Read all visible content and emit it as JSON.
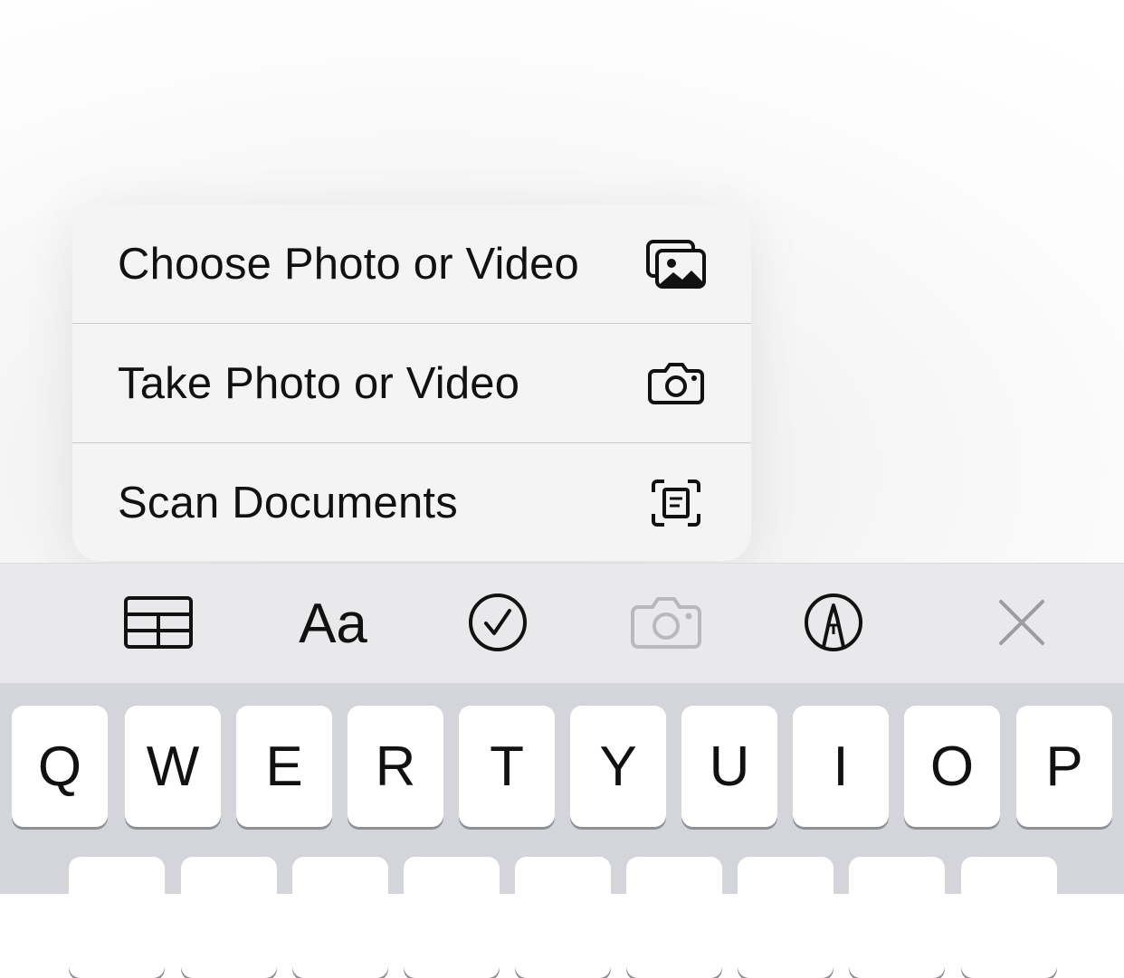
{
  "menu": {
    "items": [
      {
        "label": "Choose Photo or Video",
        "icon": "photo-library-icon"
      },
      {
        "label": "Take Photo or Video",
        "icon": "camera-icon"
      },
      {
        "label": "Scan Documents",
        "icon": "scan-document-icon"
      }
    ]
  },
  "toolbar": {
    "buttons": [
      {
        "name": "table-icon"
      },
      {
        "name": "format-text-icon",
        "label": "Aa"
      },
      {
        "name": "checklist-icon"
      },
      {
        "name": "camera-icon",
        "state": "disabled"
      },
      {
        "name": "markup-pen-icon"
      },
      {
        "name": "close-icon"
      }
    ]
  },
  "keyboard": {
    "row1": [
      "Q",
      "W",
      "E",
      "R",
      "T",
      "Y",
      "U",
      "I",
      "O",
      "P"
    ],
    "row2": [
      "",
      "",
      "",
      "",
      "",
      "",
      "",
      "",
      ""
    ]
  },
  "colors": {
    "menu_bg": "#f4f4f5",
    "toolbar_bg": "#e9e9ec",
    "keyboard_bg": "#d3d5da",
    "disabled_icon": "#b9b9bd",
    "icon": "#111111"
  }
}
